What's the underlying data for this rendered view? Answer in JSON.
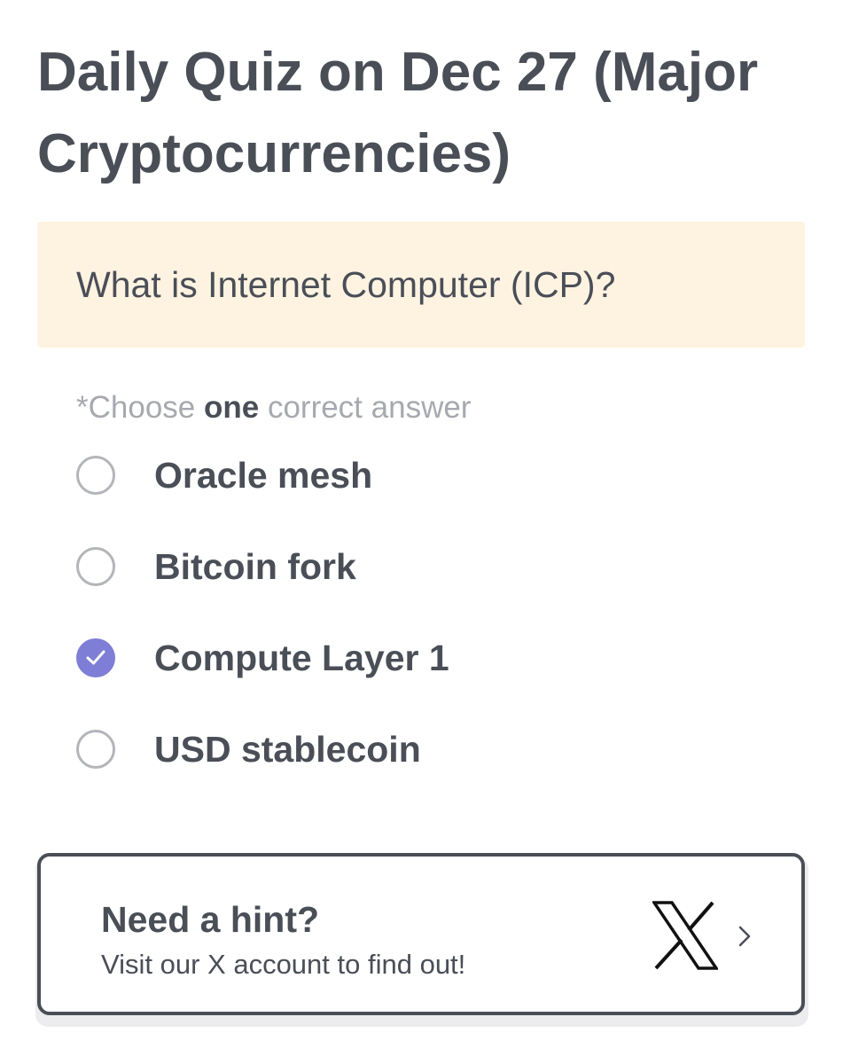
{
  "page": {
    "title": "Daily Quiz on Dec 27 (Major Cryptocurrencies)"
  },
  "question": {
    "text": "What is Internet Computer (ICP)?"
  },
  "instruction": {
    "prefix": "*Choose ",
    "emphasis": "one",
    "suffix": " correct answer"
  },
  "options": [
    {
      "label": "Oracle mesh",
      "selected": false
    },
    {
      "label": "Bitcoin fork",
      "selected": false
    },
    {
      "label": "Compute Layer 1",
      "selected": true
    },
    {
      "label": "USD stablecoin",
      "selected": false
    }
  ],
  "hint": {
    "title": "Need a hint?",
    "subtitle": "Visit our X account to find out!",
    "icon": "x-logo-icon",
    "arrow_icon": "chevron-right-icon"
  },
  "colors": {
    "text": "#4a4e57",
    "muted": "#a6a9ae",
    "question_bg": "#fef3e1",
    "accent": "#7e7ed6",
    "radio_border": "#b3b5b9"
  }
}
